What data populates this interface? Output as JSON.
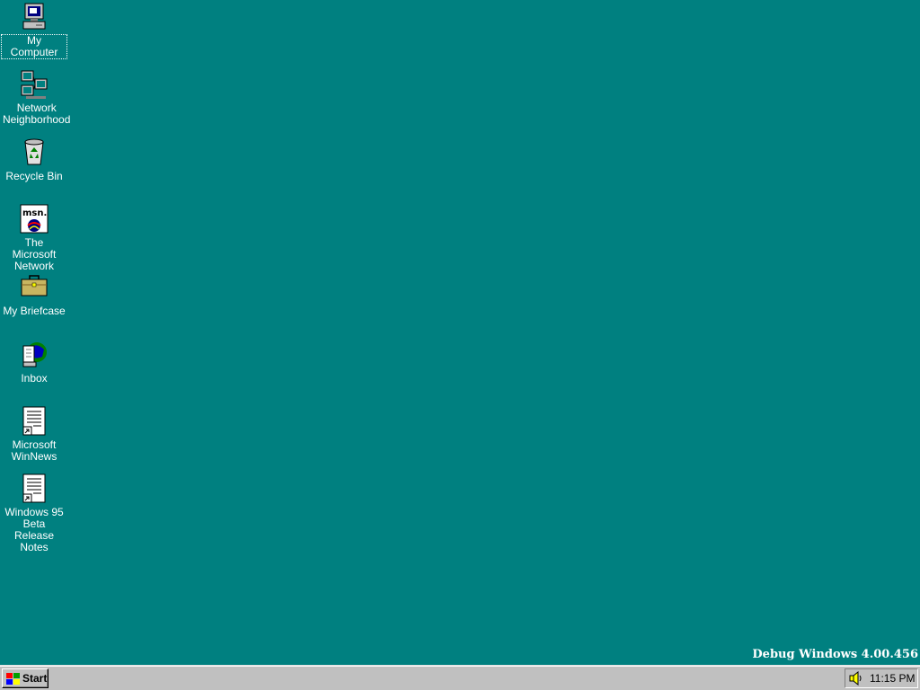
{
  "desktop": {
    "background_color": "#008080",
    "icons": [
      {
        "label": "My Computer",
        "icon": "my-computer-icon",
        "selected": true
      },
      {
        "label": "Network\nNeighborhood",
        "icon": "network-neighborhood-icon"
      },
      {
        "label": "Recycle Bin",
        "icon": "recycle-bin-icon"
      },
      {
        "label": "The Microsoft\nNetwork",
        "icon": "msn-icon"
      },
      {
        "label": "My Briefcase",
        "icon": "briefcase-icon"
      },
      {
        "label": "Inbox",
        "icon": "inbox-icon"
      },
      {
        "label": "Microsoft\nWinNews",
        "icon": "document-shortcut-icon"
      },
      {
        "label": "Windows 95\nBeta Release\nNotes",
        "icon": "document-shortcut-icon"
      }
    ],
    "watermark": "Debug Windows 4.00.456"
  },
  "taskbar": {
    "start_label": "Start",
    "tray": {
      "volume_icon": "speaker-icon",
      "clock": "11:15 PM"
    }
  }
}
